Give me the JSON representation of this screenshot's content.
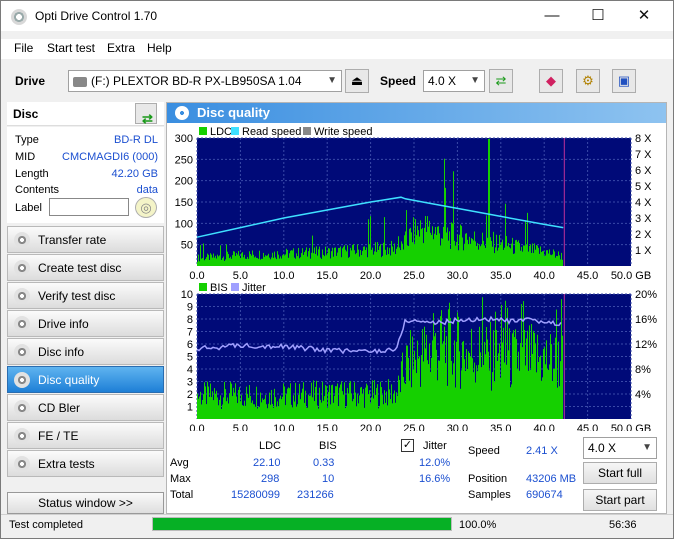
{
  "window": {
    "title": "Opti Drive Control 1.70"
  },
  "menu": [
    "File",
    "Start test",
    "Extra",
    "Help"
  ],
  "toolbar": {
    "drive_label": "Drive",
    "drive_value": "(F:)   PLEXTOR BD-R  PX-LB950SA 1.04",
    "speed_label": "Speed",
    "speed_value": "4.0 X"
  },
  "disc": {
    "header": "Disc",
    "fields": [
      {
        "key": "Type",
        "value": "BD-R DL"
      },
      {
        "key": "MID",
        "value": "CMCMAGDI6 (000)"
      },
      {
        "key": "Length",
        "value": "42.20 GB"
      },
      {
        "key": "Contents",
        "value": "data"
      },
      {
        "key": "Label",
        "value": ""
      }
    ]
  },
  "nav": [
    "Transfer rate",
    "Create test disc",
    "Verify test disc",
    "Drive info",
    "Disc info",
    "Disc quality",
    "CD Bler",
    "FE / TE",
    "Extra tests"
  ],
  "nav_active": "Disc quality",
  "status_window": "Status window >>",
  "panel": {
    "title": "Disc quality"
  },
  "chart_data": [
    {
      "type": "bar",
      "legend": [
        "LDC",
        "Read speed",
        "Write speed"
      ],
      "x_ticks": [
        "0.0",
        "5.0",
        "10.0",
        "15.0",
        "20.0",
        "25.0",
        "30.0",
        "35.0",
        "40.0",
        "45.0",
        "50.0 GB"
      ],
      "y_ticks_left": [
        "300",
        "250",
        "200",
        "150",
        "100",
        "50"
      ],
      "y_ticks_right": [
        "8 X",
        "7 X",
        "6 X",
        "5 X",
        "4 X",
        "3 X",
        "2 X",
        "1 X"
      ],
      "xlim": [
        0,
        50
      ],
      "ylim": [
        0,
        300
      ],
      "ldc": {
        "x": [
          0,
          2,
          4,
          6,
          8,
          10,
          12,
          14,
          16,
          18,
          20,
          22,
          23.5,
          24,
          25,
          26,
          27,
          28,
          29,
          30,
          31,
          32,
          33,
          34,
          35,
          36,
          37,
          38,
          39,
          40,
          41,
          42,
          42.2
        ],
        "y": [
          20,
          22,
          25,
          28,
          30,
          30,
          32,
          33,
          35,
          38,
          40,
          42,
          45,
          60,
          85,
          95,
          90,
          80,
          75,
          70,
          72,
          65,
          60,
          58,
          55,
          50,
          45,
          40,
          38,
          35,
          30,
          25,
          20
        ]
      },
      "read_speed": {
        "x": [
          0,
          5,
          10,
          15,
          20,
          23.5,
          24,
          27,
          30,
          35,
          40,
          42.2
        ],
        "y": [
          1.8,
          2.4,
          3.0,
          3.5,
          4.0,
          4.3,
          4.2,
          3.9,
          3.6,
          3.1,
          2.6,
          2.4
        ]
      }
    },
    {
      "type": "bar",
      "legend": [
        "BIS",
        "Jitter"
      ],
      "x_ticks": [
        "0.0",
        "5.0",
        "10.0",
        "15.0",
        "20.0",
        "25.0",
        "30.0",
        "35.0",
        "40.0",
        "45.0",
        "50.0 GB"
      ],
      "y_ticks_left": [
        "10",
        "9",
        "8",
        "7",
        "6",
        "5",
        "4",
        "3",
        "2",
        "1"
      ],
      "y_ticks_right": [
        "20%",
        "16%",
        "12%",
        "8%",
        "4%"
      ],
      "xlim": [
        0,
        50
      ],
      "ylim": [
        0,
        10
      ],
      "bis": {
        "x": [
          0,
          5,
          10,
          15,
          20,
          23,
          24,
          26,
          28,
          30,
          32,
          34,
          36,
          38,
          40,
          42.2
        ],
        "y": [
          2.0,
          2.0,
          2.0,
          2.1,
          2.1,
          2.2,
          4.5,
          5.5,
          6.0,
          5.8,
          5.5,
          5.2,
          5.0,
          5.2,
          5.0,
          4.8
        ]
      },
      "jitter": {
        "x": [
          0,
          5,
          10,
          15,
          20,
          23,
          24,
          26,
          28,
          30,
          32,
          34,
          36,
          38,
          40,
          42.2
        ],
        "y": [
          11.2,
          11.8,
          11.6,
          11.0,
          10.8,
          11.2,
          15.8,
          15.6,
          15.4,
          15.8,
          15.9,
          16.0,
          15.6,
          15.8,
          15.5,
          15.2
        ]
      }
    }
  ],
  "stats": {
    "col_ldc": "LDC",
    "col_bis": "BIS",
    "jitter_label": "Jitter",
    "rows": [
      {
        "label": "Avg",
        "ldc": "22.10",
        "bis": "0.33",
        "jitter": "12.0%"
      },
      {
        "label": "Max",
        "ldc": "298",
        "bis": "10",
        "jitter": "16.6%"
      },
      {
        "label": "Total",
        "ldc": "15280099",
        "bis": "231266",
        "jitter": ""
      }
    ],
    "speed_label": "Speed",
    "speed_value": "2.41 X",
    "position_label": "Position",
    "position_value": "43206 MB",
    "samples_label": "Samples",
    "samples_value": "690674",
    "speed_select": "4.0 X",
    "start_full": "Start full",
    "start_part": "Start part"
  },
  "statusbar": {
    "text": "Test completed",
    "progress": "100.0%",
    "progress_fraction": 1.0,
    "time": "56:36"
  },
  "colors": {
    "plot_bg": "#000a78",
    "ldc": "#15d000",
    "read": "#3fe0ff",
    "jitter": "#a0a0ff",
    "accent": "#1e7fd6"
  }
}
